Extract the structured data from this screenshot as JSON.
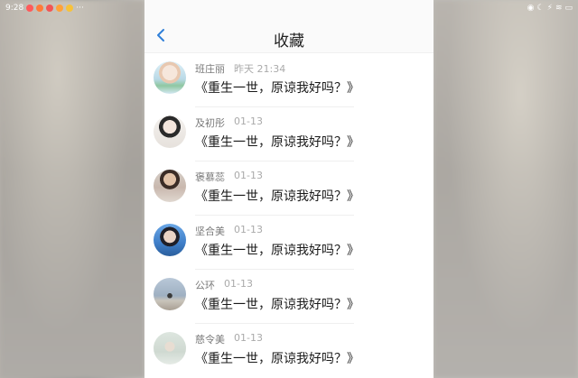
{
  "status_bar": {
    "time": "9:28",
    "more": "···"
  },
  "header": {
    "title": "收藏"
  },
  "items": [
    {
      "name": "班庄丽",
      "time": "昨天 21:34",
      "content": "《重生一世，原谅我好吗？》"
    },
    {
      "name": "及初彤",
      "time": "01-13",
      "content": "《重生一世，原谅我好吗？》"
    },
    {
      "name": "褒慕蕊",
      "time": "01-13",
      "content": "《重生一世，原谅我好吗？》"
    },
    {
      "name": "坚合美",
      "time": "01-13",
      "content": "《重生一世，原谅我好吗？》"
    },
    {
      "name": "公环",
      "time": "01-13",
      "content": "《重生一世，原谅我好吗？》"
    },
    {
      "name": "慈令美",
      "time": "01-13",
      "content": "《重生一世，原谅我好吗？》"
    }
  ],
  "colors": {
    "accent": "#2f7fd8",
    "text": "#1a1a1a",
    "muted": "#7a7a7a"
  }
}
